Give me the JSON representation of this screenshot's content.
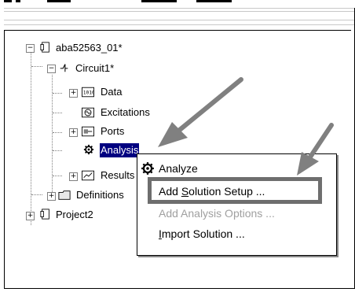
{
  "tree": {
    "root_label": "aba52563_01*",
    "circuit_label": "Circuit1*",
    "children": [
      "Data",
      "Excitations",
      "Ports",
      "Analysis",
      "Results"
    ],
    "definitions_label": "Definitions",
    "project2_label": "Project2"
  },
  "context_menu": {
    "items": [
      {
        "label": "Analyze",
        "enabled": true,
        "mnemonic": ""
      },
      {
        "label_pre": "Add ",
        "label_mn": "S",
        "label_post": "olution Setup ...",
        "enabled": true,
        "highlighted": true
      },
      {
        "label": "Add Analysis Options ...",
        "enabled": false
      },
      {
        "label_pre": "",
        "label_mn": "I",
        "label_post": "mport Solution ...",
        "enabled": true
      }
    ]
  },
  "colors": {
    "highlight_box": "#6e6e6e",
    "arrow": "#808080",
    "selection": "#000080"
  }
}
